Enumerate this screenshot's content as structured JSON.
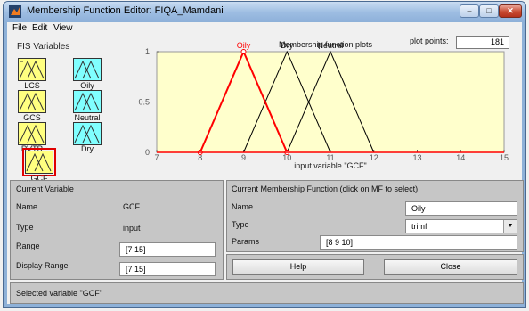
{
  "window": {
    "title": "Membership Function Editor: FIQA_Mamdani"
  },
  "menu": [
    "File",
    "Edit",
    "View"
  ],
  "fis": {
    "title": "FIS Variables",
    "inputs": [
      "LCS",
      "GCS",
      "RVTR",
      "GCF"
    ],
    "outputs": [
      "Oily",
      "Neutral",
      "Dry"
    ],
    "selected": "GCF"
  },
  "plot": {
    "title": "Membership function plots",
    "points_label": "plot points:",
    "points_value": "181",
    "xlabel": "input variable \"GCF\""
  },
  "chart_data": {
    "type": "line",
    "title": "Membership function plots",
    "xlabel": "input variable \"GCF\"",
    "xlim": [
      7,
      15
    ],
    "ylim": [
      0,
      1
    ],
    "x_ticks": [
      "7",
      "8",
      "9",
      "10",
      "11",
      "12",
      "13",
      "14",
      "15"
    ],
    "y_ticks": [
      "0",
      "0.5",
      "1"
    ],
    "series": [
      {
        "name": "Oily",
        "points": [
          [
            8,
            0
          ],
          [
            9,
            1
          ],
          [
            10,
            0
          ]
        ],
        "color": "#ff0000",
        "selected": true
      },
      {
        "name": "Dry",
        "points": [
          [
            9,
            0
          ],
          [
            10,
            1
          ],
          [
            11,
            0
          ]
        ],
        "color": "#000000"
      },
      {
        "name": "Neutral",
        "points": [
          [
            10,
            0
          ],
          [
            11,
            1
          ],
          [
            12,
            0
          ]
        ],
        "color": "#000000"
      }
    ]
  },
  "current_variable": {
    "title": "Current Variable",
    "name_label": "Name",
    "name_value": "GCF",
    "type_label": "Type",
    "type_value": "input",
    "range_label": "Range",
    "range_value": "[7 15]",
    "display_range_label": "Display Range",
    "display_range_value": "[7 15]"
  },
  "current_mf": {
    "title": "Current Membership Function (click on MF to select)",
    "name_label": "Name",
    "name_value": "Oily",
    "type_label": "Type",
    "type_value": "trimf",
    "params_label": "Params",
    "params_value": "[8 9 10]"
  },
  "buttons": {
    "help": "Help",
    "close": "Close"
  },
  "status": "Selected variable \"GCF\"",
  "colors": {
    "input_var": "#ffff80",
    "output_var": "#80ffff",
    "plot_bg": "#ffffcc",
    "selected_mf": "#ff0000"
  }
}
